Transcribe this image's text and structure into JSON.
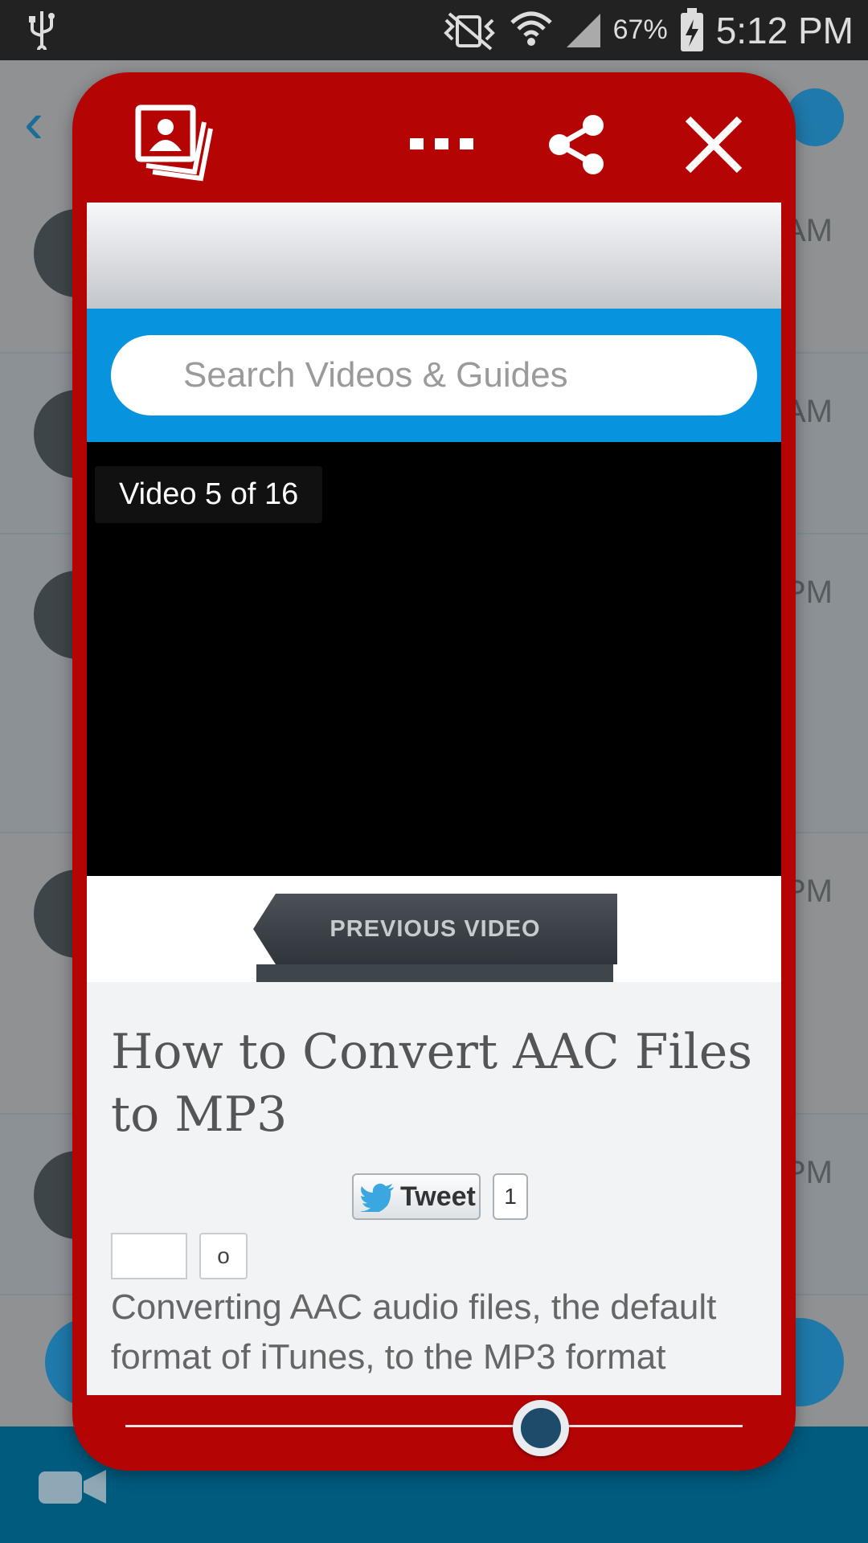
{
  "status_bar": {
    "battery": "67%",
    "time": "5:12 PM"
  },
  "background": {
    "row_times": [
      "AM",
      "AM",
      "PM",
      "PM",
      "PM"
    ]
  },
  "popup": {
    "toolbar": {
      "icons": [
        "contacts-stack-icon",
        "more-icon",
        "share-icon",
        "close-icon"
      ]
    },
    "web": {
      "search_placeholder": "Search Videos & Guides",
      "video_counter": "Video 5 of 16",
      "prev_button": "PREVIOUS VIDEO",
      "title": "How to Convert AAC Files to MP3",
      "tweet_label": "Tweet",
      "tweet_count": "1",
      "like_count": "o",
      "body_text": "Converting AAC audio files, the default format of iTunes, to the MP3 format"
    },
    "slider": {
      "position": 0.68
    }
  },
  "colors": {
    "popup_red": "#b40504",
    "search_blue": "#0793dd",
    "bottom_bar": "#005b7f"
  }
}
